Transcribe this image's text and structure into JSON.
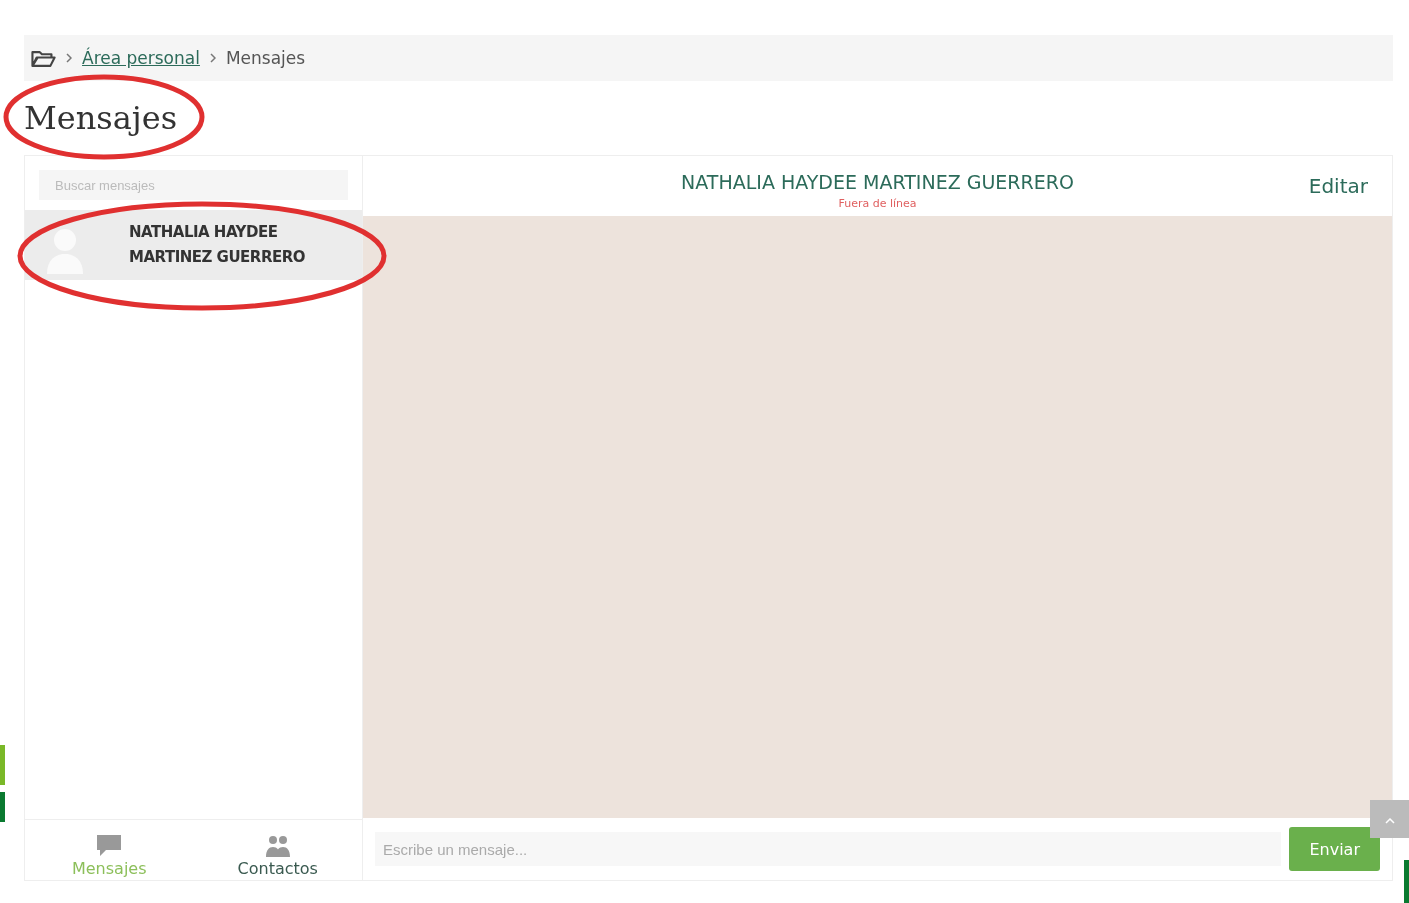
{
  "breadcrumb": [
    {
      "label": "Área personal",
      "kind": "link"
    },
    {
      "label": "Mensajes",
      "kind": "current"
    }
  ],
  "page_title": "Mensajes",
  "search": {
    "placeholder": "Buscar mensajes"
  },
  "conversations": [
    {
      "name": "NATHALIA HAYDEE MARTINEZ GUERRERO",
      "selected": true
    }
  ],
  "tabs": [
    {
      "label": "Mensajes",
      "selected": true,
      "kind": "messages"
    },
    {
      "label": "Contactos",
      "selected": false,
      "kind": "contacts"
    }
  ],
  "chat": {
    "name": "NATHALIA HAYDEE MARTINEZ GUERRERO",
    "status": "Fuera de línea",
    "edit": "Editar"
  },
  "composer": {
    "placeholder": "Escribe un mensaje...",
    "send": "Enviar"
  }
}
